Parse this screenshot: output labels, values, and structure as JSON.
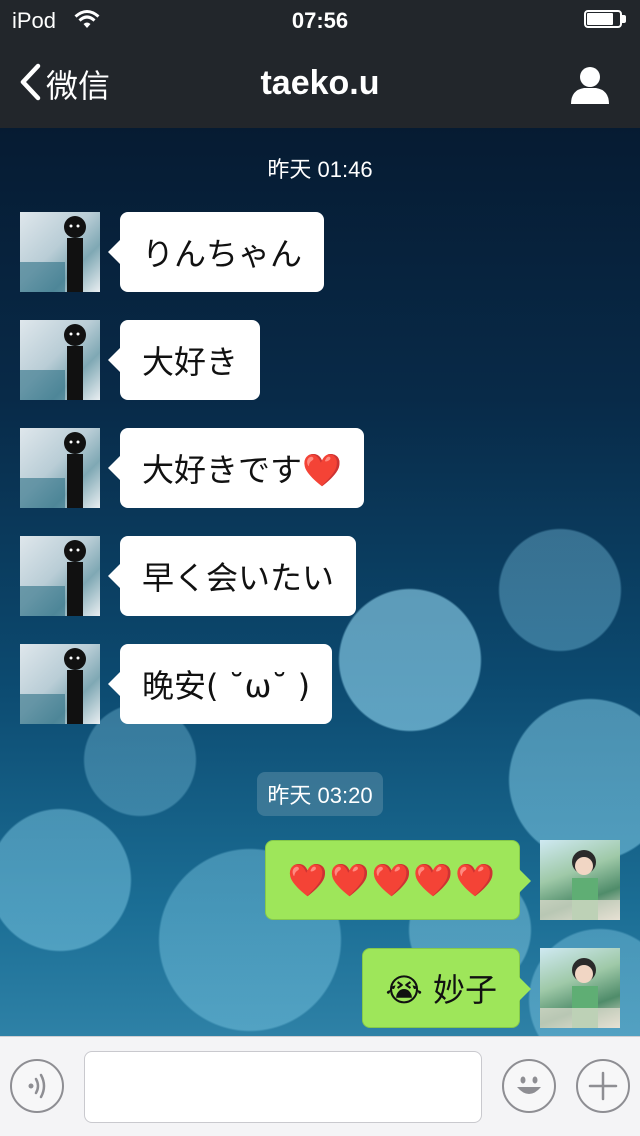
{
  "status_bar": {
    "carrier": "iPod",
    "time": "07:56",
    "battery_level": 0.8
  },
  "nav": {
    "back_label": "微信",
    "title": "taeko.u"
  },
  "timestamps": [
    "昨天 01:46",
    "昨天 03:20"
  ],
  "received_messages": [
    {
      "text": "りんちゃん"
    },
    {
      "text": "大好き"
    },
    {
      "text": "大好きです❤️"
    },
    {
      "text": "早く会いたい"
    },
    {
      "text": "晚安( ˘ω˘ )"
    }
  ],
  "sent_messages": [
    {
      "text": "❤️❤️❤️❤️❤️"
    },
    {
      "text": "😭 妙子"
    }
  ],
  "input": {
    "value": "",
    "placeholder": ""
  },
  "colors": {
    "bar": "#22262b",
    "sent_bubble": "#9ee65a",
    "received_bubble": "#ffffff",
    "heart": "#ff5a1f"
  },
  "icons": [
    "back-chevron-icon",
    "wifi-icon",
    "battery-icon",
    "profile-icon",
    "voice-icon",
    "emoji-icon",
    "plus-icon"
  ]
}
